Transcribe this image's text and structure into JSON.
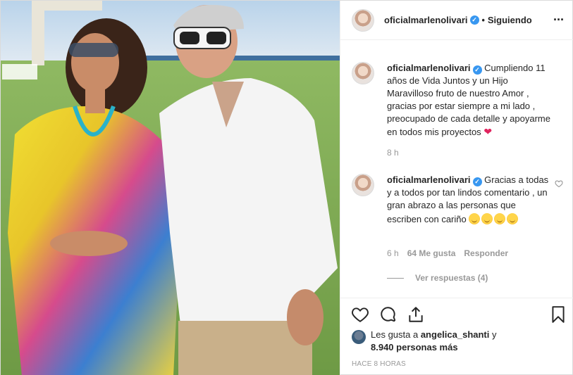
{
  "post": {
    "username": "oficialmarlenolivari",
    "follow_status": "Siguiendo",
    "more_icon": "more-options-icon"
  },
  "comments": [
    {
      "username": "oficialmarlenolivari",
      "text": "Cumpliendo 11 años de Vida Juntos y un Hijo Maravilloso fruto de nuestro Amor , gracias por estar siempre a mi lado , preocupado de cada detalle y apoyarme en todos mis proyectos",
      "emoji": "red-heart",
      "time": "8 h"
    },
    {
      "username": "oficialmarlenolivari",
      "text": "Gracias a todas y a todos por tan lindos comentario , un gran abrazo a las personas que escriben con cariño",
      "emoji_count": 4,
      "time": "6 h",
      "likes": "64 Me gusta",
      "reply": "Responder",
      "view_replies": "Ver respuestas (4)"
    }
  ],
  "actions": {
    "like_icon": "heart-icon",
    "comment_icon": "comment-icon",
    "share_icon": "share-icon",
    "save_icon": "bookmark-icon"
  },
  "likes": {
    "prefix": "Les gusta a ",
    "user": "angelica_shanti",
    "connector": " y",
    "count": "8.940 personas más"
  },
  "timestamp": "HACE 8 HORAS",
  "colors": {
    "verified": "#3897f0",
    "meta_text": "#999999",
    "border": "#efefef"
  }
}
